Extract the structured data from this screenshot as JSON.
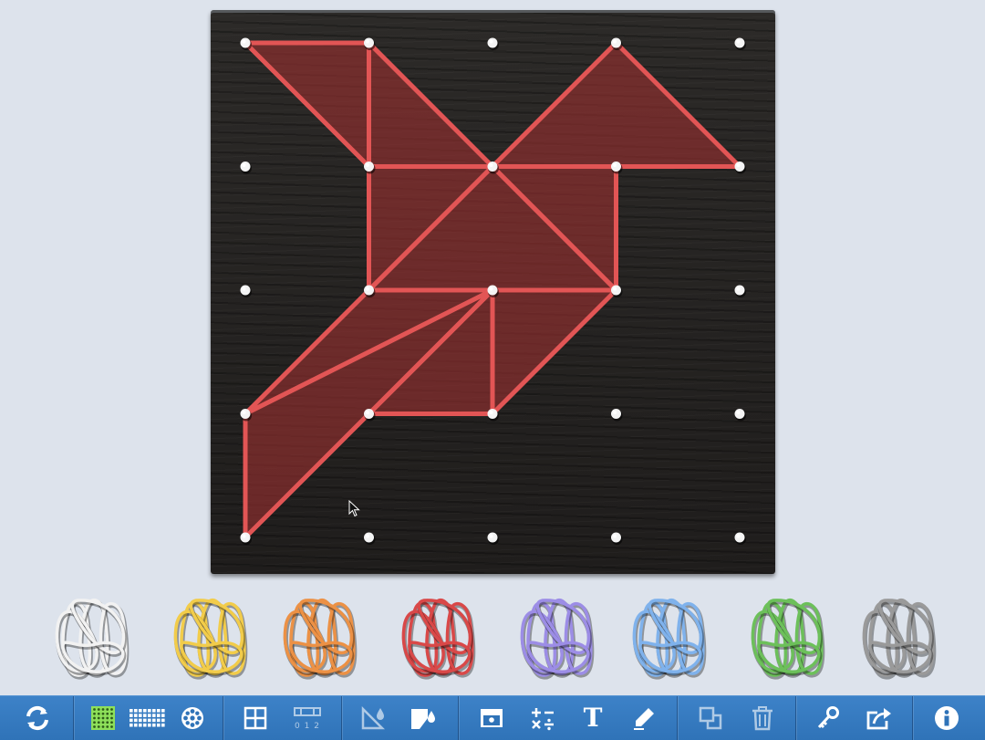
{
  "board": {
    "peg_rows": 5,
    "peg_cols": 5,
    "band_color": "#e25555",
    "fill_color": "#9a3030",
    "shapes": [
      [
        [
          0,
          0
        ],
        [
          1,
          0
        ],
        [
          1,
          1
        ]
      ],
      [
        [
          1,
          0
        ],
        [
          2,
          1
        ],
        [
          1,
          1
        ]
      ],
      [
        [
          1,
          1
        ],
        [
          2,
          1
        ],
        [
          1,
          2
        ]
      ],
      [
        [
          3,
          0
        ],
        [
          4,
          1
        ],
        [
          2,
          1
        ]
      ],
      [
        [
          2,
          1
        ],
        [
          3,
          1
        ],
        [
          3,
          2
        ]
      ],
      [
        [
          2,
          1
        ],
        [
          3,
          2
        ],
        [
          1,
          2
        ]
      ],
      [
        [
          1,
          2
        ],
        [
          2,
          2
        ],
        [
          0,
          3
        ]
      ],
      [
        [
          2,
          2
        ],
        [
          2,
          3
        ],
        [
          1,
          3
        ]
      ],
      [
        [
          2,
          2
        ],
        [
          3,
          2
        ],
        [
          2,
          3
        ]
      ],
      [
        [
          0,
          3
        ],
        [
          2,
          2
        ],
        [
          0,
          4
        ]
      ]
    ]
  },
  "band_tray": {
    "colors": [
      {
        "name": "white",
        "hex": "#f2f2f2"
      },
      {
        "name": "yellow",
        "hex": "#f2cc4a"
      },
      {
        "name": "orange",
        "hex": "#ec9145"
      },
      {
        "name": "red",
        "hex": "#d94848"
      },
      {
        "name": "purple",
        "hex": "#9c8de6"
      },
      {
        "name": "blue",
        "hex": "#7fb2ec"
      },
      {
        "name": "green",
        "hex": "#6cc05a"
      },
      {
        "name": "gray",
        "hex": "#9a9a9a"
      }
    ]
  },
  "toolbar": {
    "numbers_label": "0 1 2",
    "text_tool_label": "T",
    "icons": [
      "refresh-icon",
      "grid-square-icon",
      "grid-rect-icon",
      "circle-board-icon",
      "grid-overlay-icon",
      "number-line-icon",
      "triangle-fill-icon",
      "shape-fill-icon",
      "drawer-icon",
      "operations-icon",
      "text-icon",
      "pen-icon",
      "duplicate-icon",
      "trash-icon",
      "key-icon",
      "share-icon",
      "info-icon"
    ]
  }
}
